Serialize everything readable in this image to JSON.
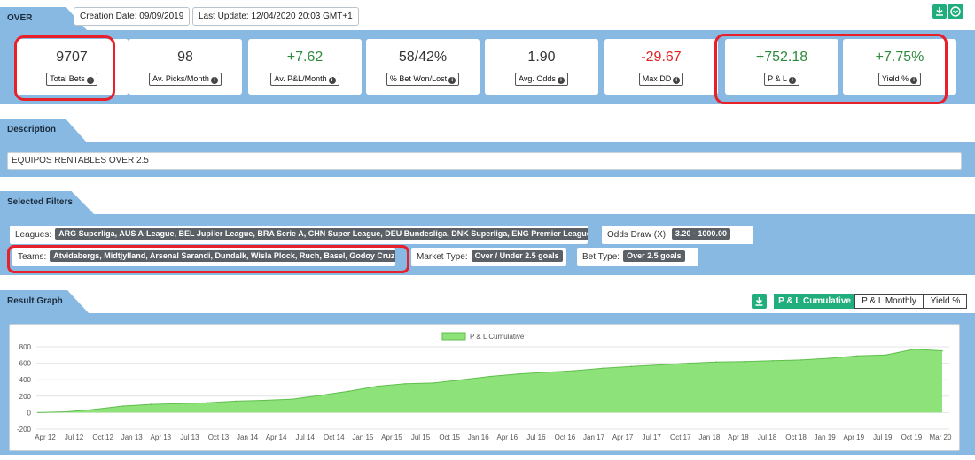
{
  "header": {
    "tab_label": "OVER",
    "creation_date": "Creation Date: 09/09/2019",
    "last_update": "Last Update: 12/04/2020 20:03 GMT+1"
  },
  "stats": [
    {
      "value": "9707",
      "label": "Total Bets",
      "tone": "neutral"
    },
    {
      "value": "98",
      "label": "Av. Picks/Month",
      "tone": "neutral"
    },
    {
      "value": "+7.62",
      "label": "Av. P&L/Month",
      "tone": "pos"
    },
    {
      "value": "58/42%",
      "label": "% Bet Won/Lost",
      "tone": "neutral"
    },
    {
      "value": "1.90",
      "label": "Avg. Odds",
      "tone": "neutral"
    },
    {
      "value": "-29.67",
      "label": "Max DD",
      "tone": "neg"
    },
    {
      "value": "+752.18",
      "label": "P & L",
      "tone": "pos"
    },
    {
      "value": "+7.75%",
      "label": "Yield %",
      "tone": "pos"
    }
  ],
  "description": {
    "tab_label": "Description",
    "text": "EQUIPOS RENTABLES OVER 2.5"
  },
  "filters": {
    "tab_label": "Selected Filters",
    "leagues_label": "Leagues:",
    "leagues_value": "ARG Superliga, AUS A-League, BEL Jupiler League, BRA Serie A, CHN Super League, DEU Bundesliga, DNK Superliga, ENG Premier League ...",
    "odds_draw_label": "Odds Draw (X):",
    "odds_draw_value": "3.20 - 1000.00",
    "teams_label": "Teams:",
    "teams_value": "Atvidabergs, Midtjylland, Arsenal Sarandi, Dundalk, Wisla Plock, Ruch, Basel, Godoy Cruz ...",
    "market_type_label": "Market Type:",
    "market_type_value": "Over / Under 2.5 goals",
    "bet_type_label": "Bet Type:",
    "bet_type_value": "Over 2.5 goals"
  },
  "graph": {
    "tab_label": "Result Graph",
    "tabs": [
      "P & L Cumulative",
      "P & L Monthly",
      "Yield %"
    ],
    "active_tab": 0
  },
  "icons": {
    "download": "download-icon",
    "settings": "settings-dropdown-icon"
  },
  "colors": {
    "accent_green": "#1fae7c",
    "section_blue": "#87b9e3",
    "positive": "#2e8b3e",
    "negative": "#e02424",
    "highlight": "#e8202a",
    "area_fill": "#8ee27a"
  },
  "chart_data": {
    "type": "area",
    "legend": "P & L Cumulative",
    "legend_position": "top-center",
    "grid": true,
    "ylim": [
      -200,
      800
    ],
    "yticks": [
      -200,
      0,
      200,
      400,
      600,
      800
    ],
    "xlabels": [
      "Apr 12",
      "Jul 12",
      "Oct 12",
      "Jan 13",
      "Apr 13",
      "Jul 13",
      "Oct 13",
      "Jan 14",
      "Apr 14",
      "Jul 14",
      "Oct 14",
      "Jan 15",
      "Apr 15",
      "Jul 15",
      "Oct 15",
      "Jan 16",
      "Apr 16",
      "Jul 16",
      "Oct 16",
      "Jan 17",
      "Apr 17",
      "Jul 17",
      "Oct 17",
      "Jan 18",
      "Apr 18",
      "Jul 18",
      "Oct 18",
      "Jan 19",
      "Apr 19",
      "Jul 19",
      "Oct 19",
      "Mar 20"
    ],
    "x": [
      "Apr 12",
      "Jul 12",
      "Oct 12",
      "Jan 13",
      "Apr 13",
      "Jul 13",
      "Oct 13",
      "Jan 14",
      "Apr 14",
      "Jul 14",
      "Oct 14",
      "Jan 15",
      "Apr 15",
      "Jul 15",
      "Oct 15",
      "Jan 16",
      "Apr 16",
      "Jul 16",
      "Oct 16",
      "Jan 17",
      "Apr 17",
      "Jul 17",
      "Oct 17",
      "Jan 18",
      "Apr 18",
      "Jul 18",
      "Oct 18",
      "Jan 19",
      "Apr 19",
      "Jul 19",
      "Oct 19",
      "Jan 20",
      "Mar 20"
    ],
    "values": [
      0,
      10,
      40,
      80,
      100,
      110,
      120,
      140,
      150,
      165,
      210,
      260,
      320,
      350,
      360,
      400,
      440,
      470,
      490,
      510,
      540,
      560,
      580,
      600,
      615,
      620,
      630,
      640,
      660,
      690,
      700,
      770,
      752
    ]
  }
}
